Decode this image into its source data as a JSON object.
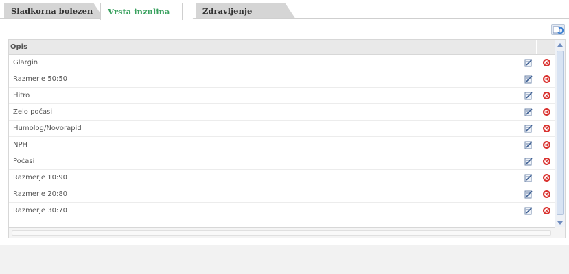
{
  "tabs": [
    {
      "label": "Sladkorna bolezen",
      "active": false
    },
    {
      "label": "Vrsta inzulina",
      "active": true
    },
    {
      "label": "Zdravljenje",
      "active": false
    }
  ],
  "colors": {
    "active_tab_text": "#3aa15f",
    "delete_icon": "#d9322f",
    "edit_icon": "#6d84a8"
  },
  "toolbar": {
    "refresh_icon": "refresh-icon"
  },
  "table": {
    "header": {
      "opis": "Opis"
    },
    "rows": [
      {
        "name": "Glargin"
      },
      {
        "name": "Razmerje 50:50"
      },
      {
        "name": "Hitro"
      },
      {
        "name": "Zelo počasi"
      },
      {
        "name": "Humolog/Novorapid"
      },
      {
        "name": "NPH"
      },
      {
        "name": "Počasi"
      },
      {
        "name": "Razmerje 10:90"
      },
      {
        "name": "Razmerje 20:80"
      },
      {
        "name": "Razmerje 30:70"
      }
    ],
    "row_icons": {
      "edit": "edit-icon",
      "delete": "delete-icon"
    }
  }
}
